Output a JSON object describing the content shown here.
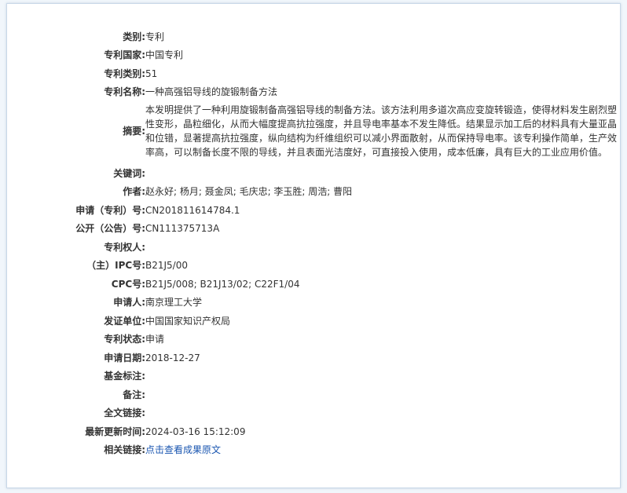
{
  "rows": {
    "category": {
      "label": "类别:",
      "value": "专利"
    },
    "country": {
      "label": "专利国家:",
      "value": "中国专利"
    },
    "patent_type": {
      "label": "专利类别:",
      "value": "51"
    },
    "title": {
      "label": "专利名称:",
      "value": "一种高强铝导线的旋锻制备方法"
    },
    "abstract": {
      "label": "摘要:",
      "value": "本发明提供了一种利用旋锻制备高强铝导线的制备方法。该方法利用多道次高应变旋转锻造，使得材料发生剧烈塑性变形，晶粒细化，从而大幅度提高抗拉强度，并且导电率基本不发生降低。结果显示加工后的材料具有大量亚晶和位错，显著提高抗拉强度，纵向结构为纤维组织可以减小界面散射，从而保持导电率。该专利操作简单，生产效率高，可以制备长度不限的导线，并且表面光洁度好，可直接投入使用，成本低廉，具有巨大的工业应用价值。"
    },
    "keywords": {
      "label": "关键词:",
      "value": ""
    },
    "authors": {
      "label": "作者:",
      "value": "赵永好; 杨月; 聂金凤; 毛庆忠; 李玉胜; 周浩; 曹阳"
    },
    "application_no": {
      "label": "申请（专利）号:",
      "value": "CN201811614784.1"
    },
    "publication_no": {
      "label": "公开（公告）号:",
      "value": "CN111375713A"
    },
    "patentee": {
      "label": "专利权人:",
      "value": ""
    },
    "ipc": {
      "label": "（主）IPC号:",
      "value": "B21J5/00"
    },
    "cpc": {
      "label": "CPC号:",
      "value": "B21J5/008; B21J13/02; C22F1/04"
    },
    "applicant": {
      "label": "申请人:",
      "value": "南京理工大学"
    },
    "issuer": {
      "label": "发证单位:",
      "value": "中国国家知识产权局"
    },
    "status": {
      "label": "专利状态:",
      "value": "申请"
    },
    "application_date": {
      "label": "申请日期:",
      "value": "2018-12-27"
    },
    "funding": {
      "label": "基金标注:",
      "value": ""
    },
    "remarks": {
      "label": "备注:",
      "value": ""
    },
    "fulltext_link": {
      "label": "全文链接:",
      "value": ""
    },
    "last_updated": {
      "label": "最新更新时间:",
      "value": "2024-03-16 15:12:09"
    },
    "related_link": {
      "label": "相关链接:",
      "value": "点击查看成果原文"
    }
  },
  "colors": {
    "label_text": "#333333",
    "value_text": "#333333",
    "link": "#1a56b0",
    "page_bg": "#f1f6fb",
    "frame_border": "#c9d8e8"
  }
}
